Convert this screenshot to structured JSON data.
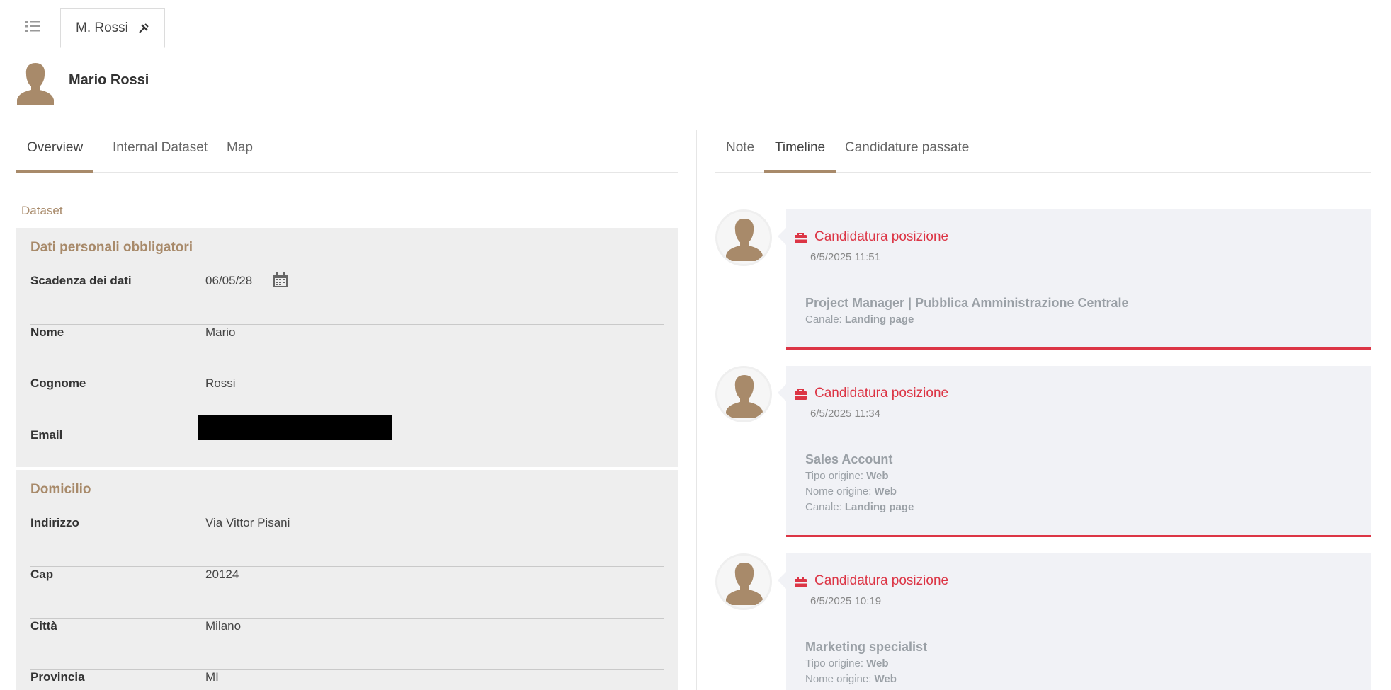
{
  "tab_strip": {
    "menu_icon": "list-icon",
    "open_tab": {
      "label": "M. Rossi",
      "close_icon": "pin-icon"
    }
  },
  "header": {
    "avatar_icon": "person-silhouette-icon",
    "name": "Mario Rossi"
  },
  "left_tabs": [
    "Overview",
    "Internal Dataset",
    "Map"
  ],
  "left_active_tab": "Overview",
  "section_caption": "Dataset",
  "personal": {
    "title": "Dati personali obbligatori",
    "rows": [
      {
        "label": "Scadenza dei dati",
        "value": "06/05/28",
        "icon": "calendar-icon"
      },
      {
        "label": "Nome",
        "value": "Mario"
      },
      {
        "label": "Cognome",
        "value": "Rossi"
      },
      {
        "label": "Email",
        "value": ""
      }
    ]
  },
  "domicile": {
    "title": "Domicilio",
    "rows": [
      {
        "label": "Indirizzo",
        "value": "Via Vittor Pisani"
      },
      {
        "label": "Cap",
        "value": "20124"
      },
      {
        "label": "Città",
        "value": "Milano"
      },
      {
        "label": "Provincia",
        "value": "MI"
      }
    ]
  },
  "right_tabs": [
    "Note",
    "Timeline",
    "Candidature passate"
  ],
  "right_active_tab": "Timeline",
  "timeline": [
    {
      "title": "Candidatura posizione",
      "date": "6/5/2025 11:51",
      "job": "Project Manager | Pubblica Amministrazione Centrale",
      "meta": [
        {
          "k": "Canale: ",
          "v": "Landing page"
        }
      ]
    },
    {
      "title": "Candidatura posizione",
      "date": "6/5/2025 11:34",
      "job": "Sales Account",
      "meta": [
        {
          "k": "Tipo origine: ",
          "v": "Web"
        },
        {
          "k": "Nome origine: ",
          "v": "Web"
        },
        {
          "k": "Canale: ",
          "v": "Landing page"
        }
      ]
    },
    {
      "title": "Candidatura posizione",
      "date": "6/5/2025 10:19",
      "job": "Marketing specialist",
      "meta": [
        {
          "k": "Tipo origine: ",
          "v": "Web"
        },
        {
          "k": "Nome origine: ",
          "v": "Web"
        }
      ]
    }
  ],
  "colors": {
    "accent": "#a88a6a",
    "timeline_red": "#dc3545",
    "card_bg": "#eeeeee",
    "timeline_bg": "#f1f2f6"
  }
}
